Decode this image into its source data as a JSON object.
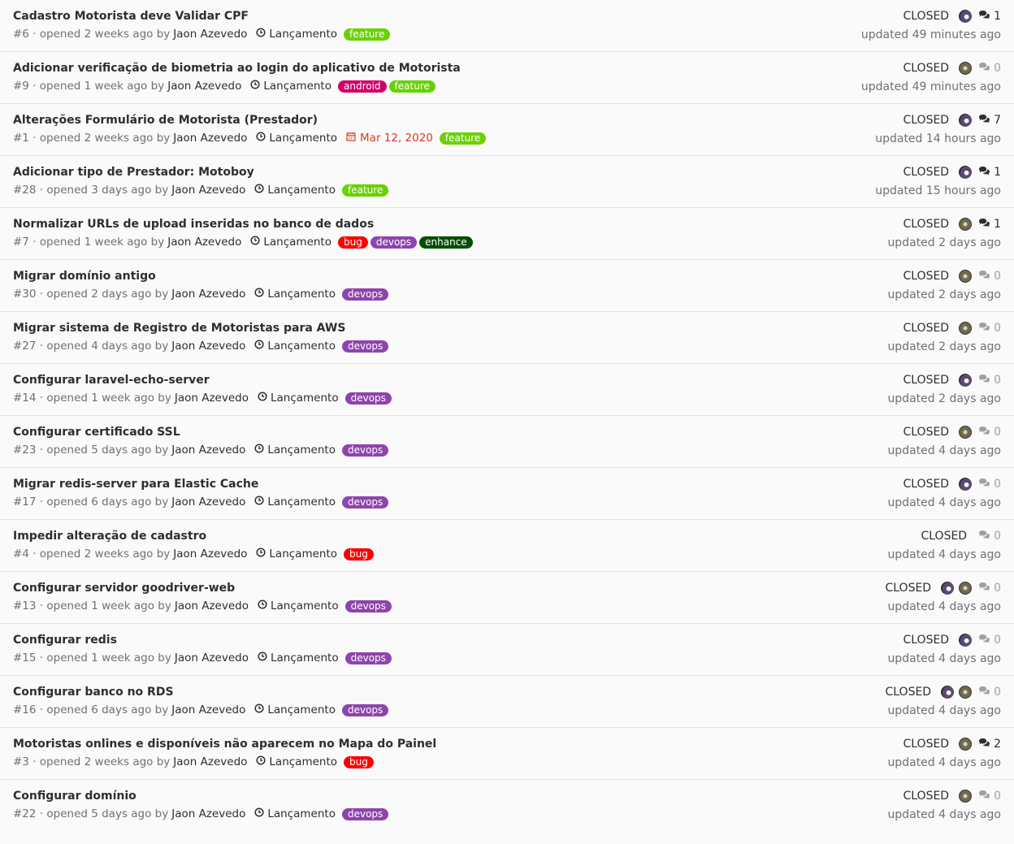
{
  "colors": {
    "feature": "#69d100",
    "android": "#d10069",
    "bug": "#ff0000",
    "devops": "#8e44ad",
    "enhance": "#004e00"
  },
  "issues": [
    {
      "title": "Cadastro Motorista deve Validar CPF",
      "number": "#6",
      "opened": "· opened 2 weeks ago by",
      "author": "Jaon Azevedo",
      "milestone": "Lançamento",
      "due": "",
      "labels": [
        "feature"
      ],
      "status": "CLOSED",
      "avatars": [
        "a1"
      ],
      "comments": "1",
      "updated": "updated 49 minutes ago"
    },
    {
      "title": "Adicionar verificação de biometria ao login do aplicativo de Motorista",
      "number": "#9",
      "opened": "· opened 1 week ago by",
      "author": "Jaon Azevedo",
      "milestone": "Lançamento",
      "due": "",
      "labels": [
        "android",
        "feature"
      ],
      "status": "CLOSED",
      "avatars": [
        "a2"
      ],
      "comments": "0",
      "updated": "updated 49 minutes ago"
    },
    {
      "title": "Alterações Formulário de Motorista (Prestador)",
      "number": "#1",
      "opened": "· opened 2 weeks ago by",
      "author": "Jaon Azevedo",
      "milestone": "Lançamento",
      "due": "Mar 12, 2020",
      "labels": [
        "feature"
      ],
      "status": "CLOSED",
      "avatars": [
        "a1"
      ],
      "comments": "7",
      "updated": "updated 14 hours ago"
    },
    {
      "title": "Adicionar tipo de Prestador: Motoboy",
      "number": "#28",
      "opened": "· opened 3 days ago by",
      "author": "Jaon Azevedo",
      "milestone": "Lançamento",
      "due": "",
      "labels": [
        "feature"
      ],
      "status": "CLOSED",
      "avatars": [
        "a1"
      ],
      "comments": "1",
      "updated": "updated 15 hours ago"
    },
    {
      "title": "Normalizar URLs de upload inseridas no banco de dados",
      "number": "#7",
      "opened": "· opened 1 week ago by",
      "author": "Jaon Azevedo",
      "milestone": "Lançamento",
      "due": "",
      "labels": [
        "bug",
        "devops",
        "enhance"
      ],
      "status": "CLOSED",
      "avatars": [
        "a2"
      ],
      "comments": "1",
      "updated": "updated 2 days ago"
    },
    {
      "title": "Migrar domínio antigo",
      "number": "#30",
      "opened": "· opened 2 days ago by",
      "author": "Jaon Azevedo",
      "milestone": "Lançamento",
      "due": "",
      "labels": [
        "devops"
      ],
      "status": "CLOSED",
      "avatars": [
        "a2"
      ],
      "comments": "0",
      "updated": "updated 2 days ago"
    },
    {
      "title": "Migrar sistema de Registro de Motoristas para AWS",
      "number": "#27",
      "opened": "· opened 4 days ago by",
      "author": "Jaon Azevedo",
      "milestone": "Lançamento",
      "due": "",
      "labels": [
        "devops"
      ],
      "status": "CLOSED",
      "avatars": [
        "a2"
      ],
      "comments": "0",
      "updated": "updated 2 days ago"
    },
    {
      "title": "Configurar laravel-echo-server",
      "number": "#14",
      "opened": "· opened 1 week ago by",
      "author": "Jaon Azevedo",
      "milestone": "Lançamento",
      "due": "",
      "labels": [
        "devops"
      ],
      "status": "CLOSED",
      "avatars": [
        "a1"
      ],
      "comments": "0",
      "updated": "updated 2 days ago"
    },
    {
      "title": "Configurar certificado SSL",
      "number": "#23",
      "opened": "· opened 5 days ago by",
      "author": "Jaon Azevedo",
      "milestone": "Lançamento",
      "due": "",
      "labels": [
        "devops"
      ],
      "status": "CLOSED",
      "avatars": [
        "a2"
      ],
      "comments": "0",
      "updated": "updated 4 days ago"
    },
    {
      "title": "Migrar redis-server para Elastic Cache",
      "number": "#17",
      "opened": "· opened 6 days ago by",
      "author": "Jaon Azevedo",
      "milestone": "Lançamento",
      "due": "",
      "labels": [
        "devops"
      ],
      "status": "CLOSED",
      "avatars": [
        "a1"
      ],
      "comments": "0",
      "updated": "updated 4 days ago"
    },
    {
      "title": "Impedir alteração de cadastro",
      "number": "#4",
      "opened": "· opened 2 weeks ago by",
      "author": "Jaon Azevedo",
      "milestone": "Lançamento",
      "due": "",
      "labels": [
        "bug"
      ],
      "status": "CLOSED",
      "avatars": [],
      "comments": "0",
      "updated": "updated 4 days ago"
    },
    {
      "title": "Configurar servidor goodriver-web",
      "number": "#13",
      "opened": "· opened 1 week ago by",
      "author": "Jaon Azevedo",
      "milestone": "Lançamento",
      "due": "",
      "labels": [
        "devops"
      ],
      "status": "CLOSED",
      "avatars": [
        "a1",
        "a2"
      ],
      "comments": "0",
      "updated": "updated 4 days ago"
    },
    {
      "title": "Configurar redis",
      "number": "#15",
      "opened": "· opened 1 week ago by",
      "author": "Jaon Azevedo",
      "milestone": "Lançamento",
      "due": "",
      "labels": [
        "devops"
      ],
      "status": "CLOSED",
      "avatars": [
        "a1"
      ],
      "comments": "0",
      "updated": "updated 4 days ago"
    },
    {
      "title": "Configurar banco no RDS",
      "number": "#16",
      "opened": "· opened 6 days ago by",
      "author": "Jaon Azevedo",
      "milestone": "Lançamento",
      "due": "",
      "labels": [
        "devops"
      ],
      "status": "CLOSED",
      "avatars": [
        "a1",
        "a2"
      ],
      "comments": "0",
      "updated": "updated 4 days ago"
    },
    {
      "title": "Motoristas onlines e disponíveis não aparecem no Mapa do Painel",
      "number": "#3",
      "opened": "· opened 2 weeks ago by",
      "author": "Jaon Azevedo",
      "milestone": "Lançamento",
      "due": "",
      "labels": [
        "bug"
      ],
      "status": "CLOSED",
      "avatars": [
        "a2"
      ],
      "comments": "2",
      "updated": "updated 4 days ago"
    },
    {
      "title": "Configurar domínio",
      "number": "#22",
      "opened": "· opened 5 days ago by",
      "author": "Jaon Azevedo",
      "milestone": "Lançamento",
      "due": "",
      "labels": [
        "devops"
      ],
      "status": "CLOSED",
      "avatars": [
        "a2"
      ],
      "comments": "0",
      "updated": "updated 4 days ago"
    }
  ]
}
